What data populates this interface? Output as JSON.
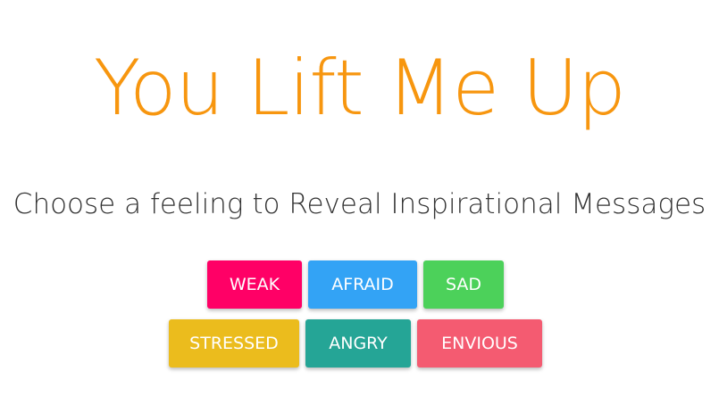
{
  "header": {
    "title": "You Lift Me Up",
    "subtitle": "Choose a feeling to Reveal Inspirational Messages"
  },
  "colors": {
    "title": "#f7960f",
    "subtitle": "#333333"
  },
  "feelings": [
    {
      "label": "WEAK",
      "color": "#ff0066"
    },
    {
      "label": "AFRAID",
      "color": "#33a3f5"
    },
    {
      "label": "SAD",
      "color": "#4cd15a"
    },
    {
      "label": "STRESSED",
      "color": "#ebbc1d"
    },
    {
      "label": "ANGRY",
      "color": "#25a596"
    },
    {
      "label": "ENVIOUS",
      "color": "#f45b71"
    }
  ]
}
